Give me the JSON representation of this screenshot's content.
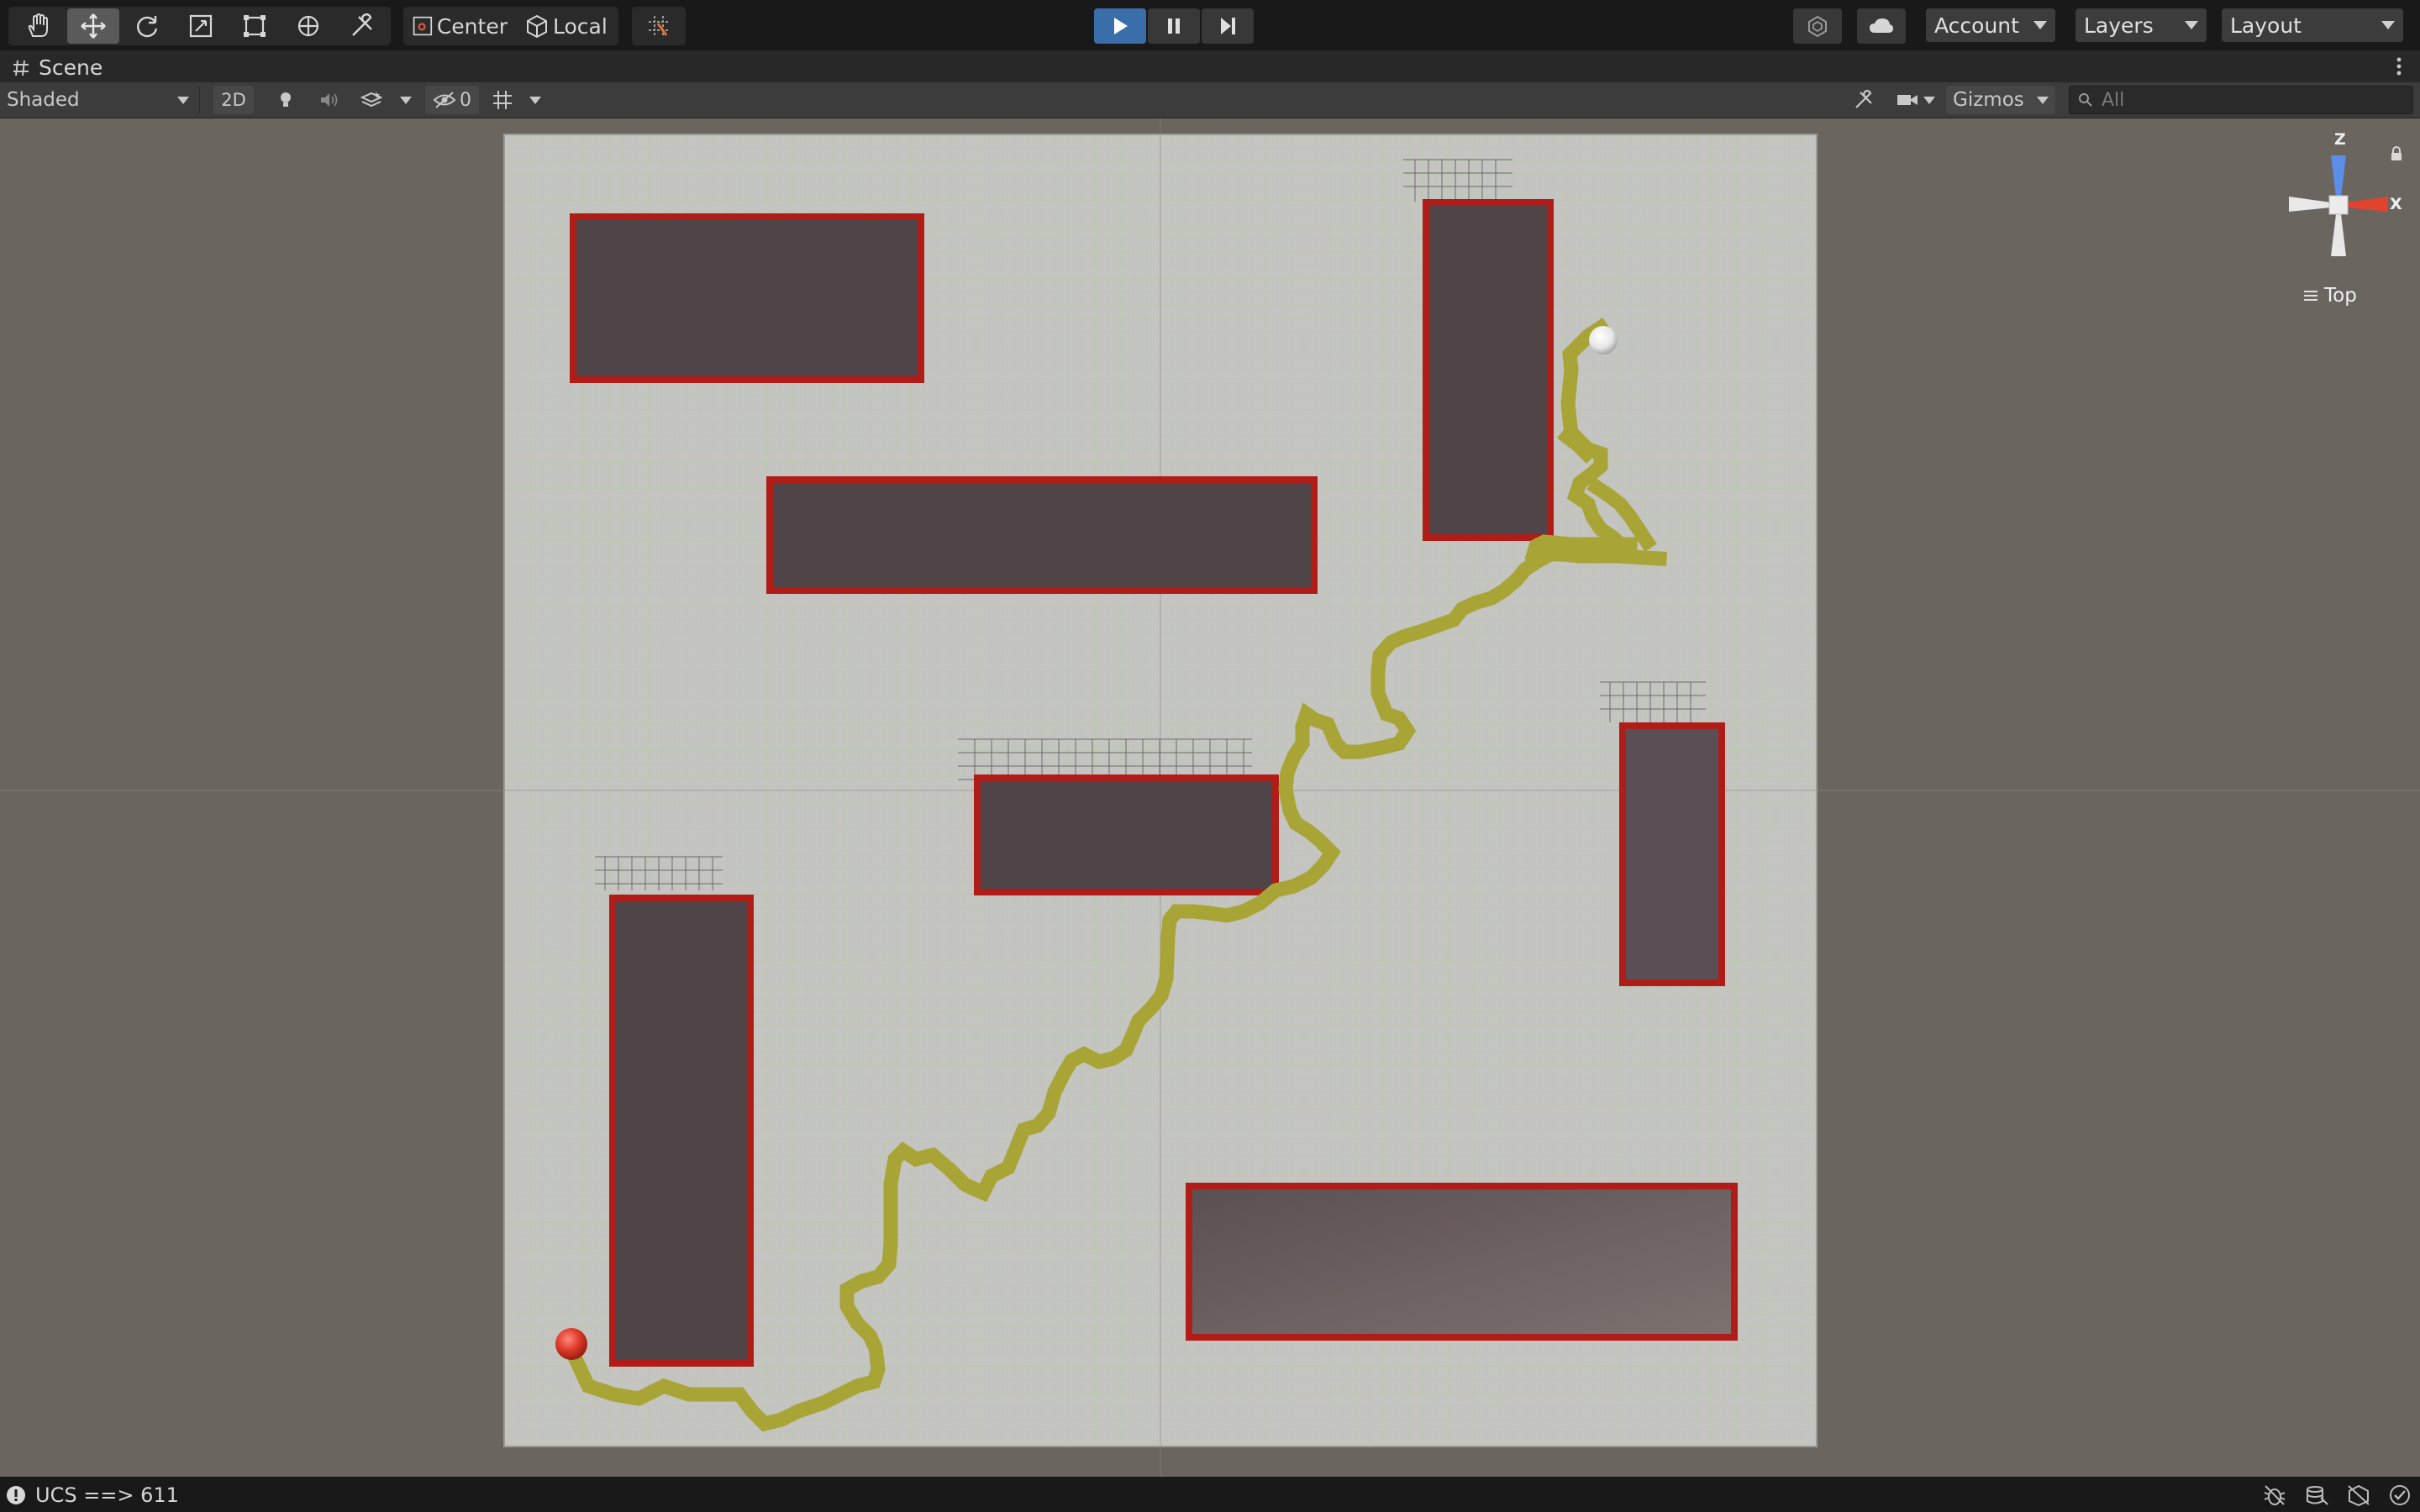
{
  "toolbar": {
    "tools": [
      {
        "name": "hand-tool",
        "icon": "hand-icon"
      },
      {
        "name": "move-tool",
        "icon": "move-icon",
        "active": true
      },
      {
        "name": "rotate-tool",
        "icon": "rotate-icon"
      },
      {
        "name": "scale-tool",
        "icon": "scale-icon"
      },
      {
        "name": "rect-tool",
        "icon": "rect-transform-icon"
      },
      {
        "name": "transform-tool",
        "icon": "transform-icon"
      },
      {
        "name": "custom-tool",
        "icon": "custom-tools-icon"
      }
    ],
    "pivot_mode": "Center",
    "pivot_rotation": "Local",
    "account_label": "Account",
    "layers_label": "Layers",
    "layout_label": "Layout"
  },
  "scene_tab": {
    "title": "Scene"
  },
  "scene_toolbar": {
    "draw_mode": "Shaded",
    "mode_2d": "2D",
    "hidden_count": "0",
    "gizmos_label": "Gizmos",
    "search_placeholder": "All"
  },
  "orientation_gizmo": {
    "z_label": "Z",
    "x_label": "X",
    "view_label": "Top"
  },
  "status": {
    "message": "UCS ==> 611"
  },
  "colors": {
    "accent_play": "#3a6ea8",
    "path": "#a8a435",
    "obstacle_border": "#b01c17",
    "obstacle_fill": "#4f4448",
    "ground": "#c4c4c0",
    "start_ball": "#e03a2a",
    "goal_ball": "#f0f0f0"
  }
}
